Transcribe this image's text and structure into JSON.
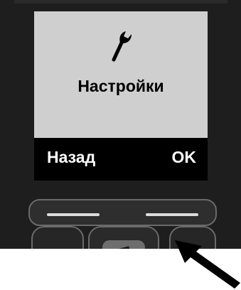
{
  "screen": {
    "icon": "wrench-icon",
    "title": "Настройки"
  },
  "softkeys": {
    "left_label": "Назад",
    "right_label": "OK"
  },
  "colors": {
    "screen_bg": "#cfcfcf",
    "softbar_bg": "#000000",
    "phone_body": "#1e1e1e"
  }
}
